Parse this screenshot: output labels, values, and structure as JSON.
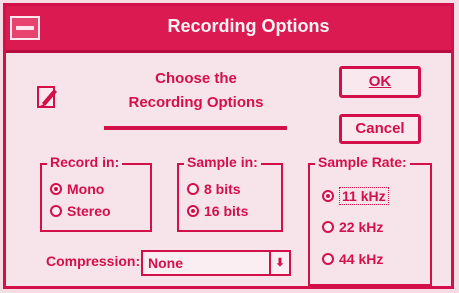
{
  "window": {
    "title": "Recording Options"
  },
  "prompt": {
    "line1": "Choose the",
    "line2": "Recording Options"
  },
  "buttons": {
    "ok": "OK",
    "cancel": "Cancel"
  },
  "record_in": {
    "label": "Record in:",
    "options": [
      {
        "label": "Mono",
        "selected": true
      },
      {
        "label": "Stereo",
        "selected": false
      }
    ]
  },
  "sample_in": {
    "label": "Sample in:",
    "options": [
      {
        "label": "8 bits",
        "selected": false
      },
      {
        "label": "16 bits",
        "selected": true
      }
    ]
  },
  "sample_rate": {
    "label": "Sample Rate:",
    "options": [
      {
        "label": "11 kHz",
        "selected": true
      },
      {
        "label": "22 kHz",
        "selected": false
      },
      {
        "label": "44 kHz",
        "selected": false
      }
    ]
  },
  "compression": {
    "label": "Compression:",
    "value": "None"
  },
  "icons": {
    "system_menu": "system-menu-icon",
    "app": "pen-icon",
    "dropdown": "arrow-down-icon"
  },
  "colors": {
    "accent": "#d4104a",
    "titlebar": "#dc1a52",
    "background": "#f7e3ea"
  }
}
